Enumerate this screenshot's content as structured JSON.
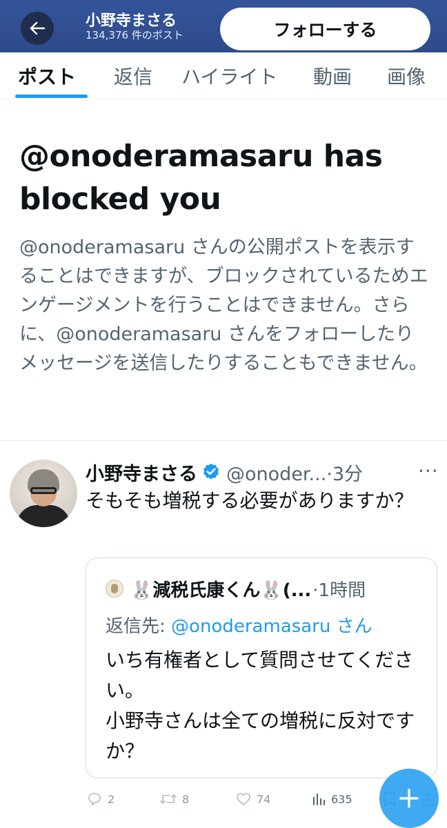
{
  "header": {
    "back_label": "←",
    "name": "小野寺まさる",
    "post_count": "134,376 件のポスト",
    "follow_label": "フォローする"
  },
  "tabs": [
    {
      "label": "ポスト",
      "active": true
    },
    {
      "label": "返信",
      "active": false
    },
    {
      "label": "ハイライト",
      "active": false
    },
    {
      "label": "動画",
      "active": false
    },
    {
      "label": "画像",
      "active": false
    }
  ],
  "blocked": {
    "title": "@onoderamasaru has blocked you",
    "description": "@onoderamasaru さんの公開ポストを表示することはできますが、ブロックされているためエンゲージメントを行うことはできません。さらに、@onoderamasaru さんをフォローしたりメッセージを送信したりすることもできません。"
  },
  "tweet": {
    "name": "小野寺まさる",
    "handle_time": "@onoder...·3分",
    "more": "···",
    "text": "そもそも増税する必要がありますか？",
    "quote": {
      "name": "🐰減税氏康くん🐰(...",
      "time": "·1時間",
      "reply_prefix": "返信先: ",
      "reply_mention": "@onoderamasaru さん",
      "text_line1": "いち有権者として質問させてください。",
      "text_line2": "小野寺さんは全ての増税に反対ですか？"
    },
    "actions": {
      "replies": "2",
      "reposts": "8",
      "likes": "74",
      "views": "635"
    }
  },
  "colors": {
    "header_bg": "#2e4a8a",
    "accent": "#1d9bf0",
    "secondary_text": "#536471"
  }
}
